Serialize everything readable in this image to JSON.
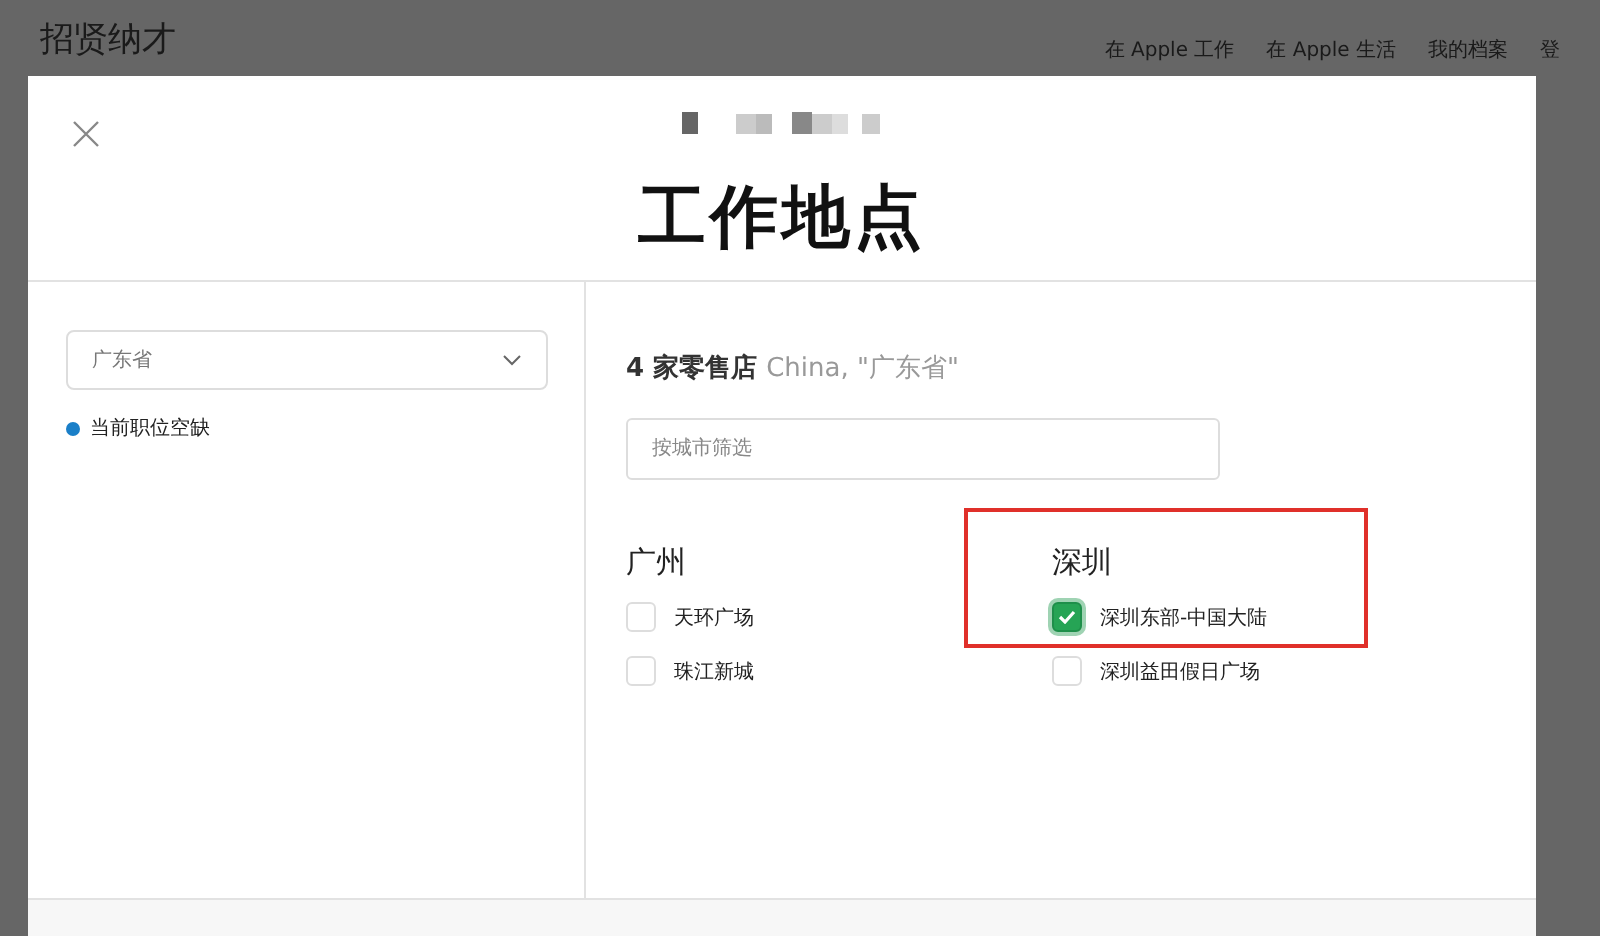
{
  "site": {
    "title": "招贤纳才",
    "nav": [
      "在 Apple 工作",
      "在 Apple 生活",
      "我的档案",
      "登"
    ]
  },
  "modal": {
    "title": "工作地点",
    "filter": {
      "province": "广东省",
      "legend": {
        "label": "当前职位空缺",
        "color": "#1a7fc8"
      }
    },
    "results": {
      "count": "4 家零售店",
      "scope": "China, \"广东省\""
    },
    "search": {
      "placeholder": "按城市筛选"
    },
    "cities": [
      {
        "name": "广州",
        "highlighted": false,
        "stores": [
          {
            "name": "天环广场",
            "checked": false
          },
          {
            "name": "珠江新城",
            "checked": false
          }
        ]
      },
      {
        "name": "深圳",
        "highlighted": true,
        "stores": [
          {
            "name": "深圳东部-中国大陆",
            "checked": true
          },
          {
            "name": "深圳益田假日广场",
            "checked": false
          }
        ]
      }
    ]
  }
}
